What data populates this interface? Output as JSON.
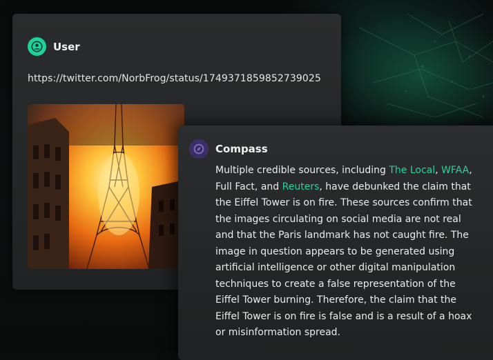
{
  "user_message": {
    "sender": "User",
    "url": "https://twitter.com/NorbFrog/status/1749371859852739025",
    "avatar_icon": "user-icon",
    "avatar_color": "#1fd19a"
  },
  "compass_message": {
    "sender": "Compass",
    "avatar_icon": "compass-icon",
    "avatar_color": "#3a2f66",
    "link_color": "#26d49b",
    "text_1": "Multiple credible sources, including ",
    "link_the_local": "The Local",
    "sep_1": ", ",
    "link_wfaa": "WFAA",
    "text_2": ", Full Fact, and ",
    "link_reuters": "Reuters",
    "text_3": ", have debunked the claim that the Eiffel Tower is on fire. These sources confirm that the images circulating on social media are not real and that the Paris landmark has not caught fire. The image in question appears to be generated using artificial intelligence or other digital manipulation techniques to create a false representation of the Eiffel Tower burning. Therefore, the claim that the Eiffel Tower is on fire is false and is a result of a hoax or misinformation spread."
  }
}
